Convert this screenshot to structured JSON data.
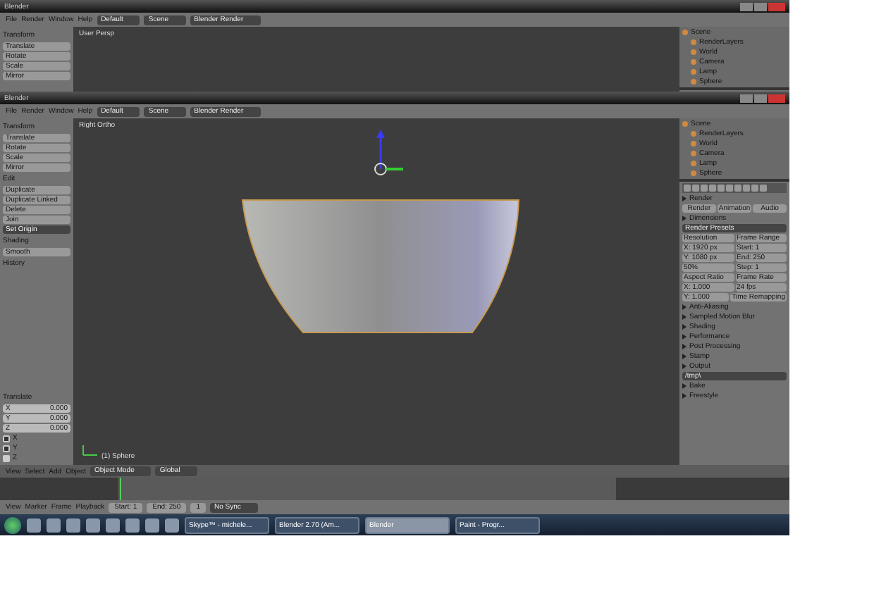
{
  "top_window": {
    "title": "Blender",
    "menus": [
      "File",
      "Render",
      "Window",
      "Help"
    ],
    "layout": "Default",
    "scene": "Scene",
    "engine": "Blender Render",
    "viewport_label": "User Persp",
    "tools": [
      {
        "kind": "heading",
        "text": "Transform"
      },
      {
        "kind": "button",
        "text": "Translate",
        "selected": false
      },
      {
        "kind": "button",
        "text": "Rotate",
        "selected": false
      },
      {
        "kind": "button",
        "text": "Scale",
        "selected": false
      },
      {
        "kind": "button",
        "text": "Mirror",
        "selected": false
      }
    ],
    "outliner": [
      "Scene",
      "RenderLayers",
      "World",
      "Camera",
      "Lamp",
      "Sphere"
    ]
  },
  "main_window": {
    "title": "Blender",
    "menus": [
      "File",
      "Render",
      "Window",
      "Help"
    ],
    "layout": "Default",
    "scene": "Scene",
    "engine": "Blender Render",
    "viewport_label": "Right Ortho",
    "object_label": "(1) Sphere",
    "tools": [
      {
        "kind": "heading",
        "text": "Transform"
      },
      {
        "kind": "button",
        "text": "Translate",
        "selected": false
      },
      {
        "kind": "button",
        "text": "Rotate",
        "selected": false
      },
      {
        "kind": "button",
        "text": "Scale",
        "selected": false
      },
      {
        "kind": "button",
        "text": "Mirror",
        "selected": false
      },
      {
        "kind": "heading",
        "text": "Edit"
      },
      {
        "kind": "button",
        "text": "Duplicate",
        "selected": false
      },
      {
        "kind": "button",
        "text": "Duplicate Linked",
        "selected": false
      },
      {
        "kind": "button",
        "text": "Delete",
        "selected": false
      },
      {
        "kind": "button",
        "text": "Join",
        "selected": false
      },
      {
        "kind": "button",
        "text": "Set Origin",
        "selected": true
      },
      {
        "kind": "heading",
        "text": "Shading"
      },
      {
        "kind": "button",
        "text": "Smooth",
        "selected": false
      },
      {
        "kind": "heading",
        "text": "History"
      }
    ],
    "operator": {
      "heading": "Translate",
      "fields": [
        {
          "label": "X",
          "value": "0.000"
        },
        {
          "label": "Y",
          "value": "0.000"
        },
        {
          "label": "Z",
          "value": "0.000"
        }
      ],
      "checks": [
        {
          "label": "X",
          "checked": true
        },
        {
          "label": "Y",
          "checked": true
        },
        {
          "label": "Z",
          "checked": false
        }
      ]
    },
    "outliner": [
      "Scene",
      "RenderLayers",
      "World",
      "Camera",
      "Lamp",
      "Sphere"
    ],
    "properties": [
      {
        "kind": "heading",
        "text": "Render"
      },
      {
        "kind": "buttons",
        "texts": [
          "Render",
          "Animation",
          "Audio"
        ]
      },
      {
        "kind": "heading",
        "text": "Dimensions"
      },
      {
        "kind": "dropdown",
        "text": "Render Presets"
      },
      {
        "kind": "pair",
        "texts": [
          "Resolution",
          "Frame Range"
        ]
      },
      {
        "kind": "pair",
        "texts": [
          "X: 1920 px",
          "Start: 1"
        ]
      },
      {
        "kind": "pair",
        "texts": [
          "Y: 1080 px",
          "End: 250"
        ]
      },
      {
        "kind": "pair",
        "texts": [
          "50%",
          "Step: 1"
        ]
      },
      {
        "kind": "pair",
        "texts": [
          "Aspect Ratio",
          "Frame Rate"
        ]
      },
      {
        "kind": "pair",
        "texts": [
          "X: 1.000",
          "24 fps"
        ]
      },
      {
        "kind": "pair",
        "texts": [
          "Y: 1.000",
          "Time Remapping"
        ]
      },
      {
        "kind": "heading",
        "text": "Anti-Aliasing"
      },
      {
        "kind": "heading",
        "text": "Sampled Motion Blur"
      },
      {
        "kind": "heading",
        "text": "Shading"
      },
      {
        "kind": "heading",
        "text": "Performance"
      },
      {
        "kind": "heading",
        "text": "Post Processing"
      },
      {
        "kind": "heading",
        "text": "Stamp"
      },
      {
        "kind": "heading",
        "text": "Output"
      },
      {
        "kind": "dropdown",
        "text": "/tmp\\"
      },
      {
        "kind": "heading",
        "text": "Bake"
      },
      {
        "kind": "heading",
        "text": "Freestyle"
      }
    ]
  },
  "view_header": {
    "menus": [
      "View",
      "Select",
      "Add",
      "Object"
    ],
    "mode": "Object Mode",
    "orientation": "Global"
  },
  "timeline": {
    "menus": [
      "View",
      "Marker",
      "Frame",
      "Playback"
    ],
    "start": "Start: 1",
    "end": "End: 250",
    "current": "1",
    "sync": "No Sync"
  },
  "taskbar": {
    "items": [
      {
        "label": "Skype™ - michele...",
        "selected": false
      },
      {
        "label": "Blender 2.70 (Am...",
        "selected": false
      },
      {
        "label": "Blender",
        "selected": true
      },
      {
        "label": "Paint - Progr...",
        "selected": false
      }
    ]
  }
}
